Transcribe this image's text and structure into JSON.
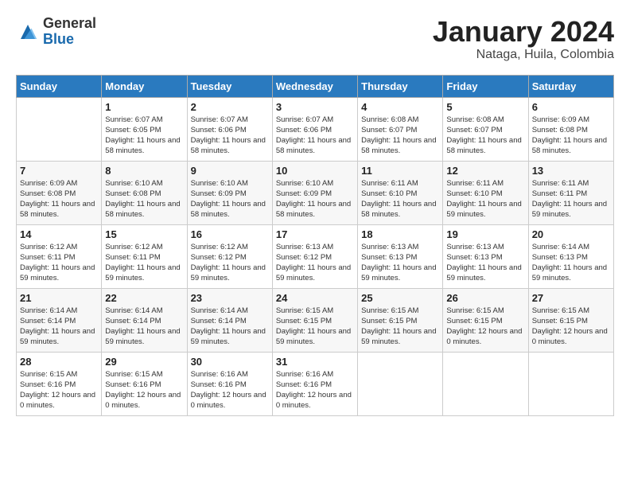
{
  "header": {
    "logo_general": "General",
    "logo_blue": "Blue",
    "month_title": "January 2024",
    "subtitle": "Nataga, Huila, Colombia"
  },
  "weekdays": [
    "Sunday",
    "Monday",
    "Tuesday",
    "Wednesday",
    "Thursday",
    "Friday",
    "Saturday"
  ],
  "weeks": [
    [
      {
        "day": "",
        "sunrise": "",
        "sunset": "",
        "daylight": ""
      },
      {
        "day": "1",
        "sunrise": "Sunrise: 6:07 AM",
        "sunset": "Sunset: 6:05 PM",
        "daylight": "Daylight: 11 hours and 58 minutes."
      },
      {
        "day": "2",
        "sunrise": "Sunrise: 6:07 AM",
        "sunset": "Sunset: 6:06 PM",
        "daylight": "Daylight: 11 hours and 58 minutes."
      },
      {
        "day": "3",
        "sunrise": "Sunrise: 6:07 AM",
        "sunset": "Sunset: 6:06 PM",
        "daylight": "Daylight: 11 hours and 58 minutes."
      },
      {
        "day": "4",
        "sunrise": "Sunrise: 6:08 AM",
        "sunset": "Sunset: 6:07 PM",
        "daylight": "Daylight: 11 hours and 58 minutes."
      },
      {
        "day": "5",
        "sunrise": "Sunrise: 6:08 AM",
        "sunset": "Sunset: 6:07 PM",
        "daylight": "Daylight: 11 hours and 58 minutes."
      },
      {
        "day": "6",
        "sunrise": "Sunrise: 6:09 AM",
        "sunset": "Sunset: 6:08 PM",
        "daylight": "Daylight: 11 hours and 58 minutes."
      }
    ],
    [
      {
        "day": "7",
        "sunrise": "Sunrise: 6:09 AM",
        "sunset": "Sunset: 6:08 PM",
        "daylight": "Daylight: 11 hours and 58 minutes."
      },
      {
        "day": "8",
        "sunrise": "Sunrise: 6:10 AM",
        "sunset": "Sunset: 6:08 PM",
        "daylight": "Daylight: 11 hours and 58 minutes."
      },
      {
        "day": "9",
        "sunrise": "Sunrise: 6:10 AM",
        "sunset": "Sunset: 6:09 PM",
        "daylight": "Daylight: 11 hours and 58 minutes."
      },
      {
        "day": "10",
        "sunrise": "Sunrise: 6:10 AM",
        "sunset": "Sunset: 6:09 PM",
        "daylight": "Daylight: 11 hours and 58 minutes."
      },
      {
        "day": "11",
        "sunrise": "Sunrise: 6:11 AM",
        "sunset": "Sunset: 6:10 PM",
        "daylight": "Daylight: 11 hours and 58 minutes."
      },
      {
        "day": "12",
        "sunrise": "Sunrise: 6:11 AM",
        "sunset": "Sunset: 6:10 PM",
        "daylight": "Daylight: 11 hours and 59 minutes."
      },
      {
        "day": "13",
        "sunrise": "Sunrise: 6:11 AM",
        "sunset": "Sunset: 6:11 PM",
        "daylight": "Daylight: 11 hours and 59 minutes."
      }
    ],
    [
      {
        "day": "14",
        "sunrise": "Sunrise: 6:12 AM",
        "sunset": "Sunset: 6:11 PM",
        "daylight": "Daylight: 11 hours and 59 minutes."
      },
      {
        "day": "15",
        "sunrise": "Sunrise: 6:12 AM",
        "sunset": "Sunset: 6:11 PM",
        "daylight": "Daylight: 11 hours and 59 minutes."
      },
      {
        "day": "16",
        "sunrise": "Sunrise: 6:12 AM",
        "sunset": "Sunset: 6:12 PM",
        "daylight": "Daylight: 11 hours and 59 minutes."
      },
      {
        "day": "17",
        "sunrise": "Sunrise: 6:13 AM",
        "sunset": "Sunset: 6:12 PM",
        "daylight": "Daylight: 11 hours and 59 minutes."
      },
      {
        "day": "18",
        "sunrise": "Sunrise: 6:13 AM",
        "sunset": "Sunset: 6:13 PM",
        "daylight": "Daylight: 11 hours and 59 minutes."
      },
      {
        "day": "19",
        "sunrise": "Sunrise: 6:13 AM",
        "sunset": "Sunset: 6:13 PM",
        "daylight": "Daylight: 11 hours and 59 minutes."
      },
      {
        "day": "20",
        "sunrise": "Sunrise: 6:14 AM",
        "sunset": "Sunset: 6:13 PM",
        "daylight": "Daylight: 11 hours and 59 minutes."
      }
    ],
    [
      {
        "day": "21",
        "sunrise": "Sunrise: 6:14 AM",
        "sunset": "Sunset: 6:14 PM",
        "daylight": "Daylight: 11 hours and 59 minutes."
      },
      {
        "day": "22",
        "sunrise": "Sunrise: 6:14 AM",
        "sunset": "Sunset: 6:14 PM",
        "daylight": "Daylight: 11 hours and 59 minutes."
      },
      {
        "day": "23",
        "sunrise": "Sunrise: 6:14 AM",
        "sunset": "Sunset: 6:14 PM",
        "daylight": "Daylight: 11 hours and 59 minutes."
      },
      {
        "day": "24",
        "sunrise": "Sunrise: 6:15 AM",
        "sunset": "Sunset: 6:15 PM",
        "daylight": "Daylight: 11 hours and 59 minutes."
      },
      {
        "day": "25",
        "sunrise": "Sunrise: 6:15 AM",
        "sunset": "Sunset: 6:15 PM",
        "daylight": "Daylight: 11 hours and 59 minutes."
      },
      {
        "day": "26",
        "sunrise": "Sunrise: 6:15 AM",
        "sunset": "Sunset: 6:15 PM",
        "daylight": "Daylight: 12 hours and 0 minutes."
      },
      {
        "day": "27",
        "sunrise": "Sunrise: 6:15 AM",
        "sunset": "Sunset: 6:15 PM",
        "daylight": "Daylight: 12 hours and 0 minutes."
      }
    ],
    [
      {
        "day": "28",
        "sunrise": "Sunrise: 6:15 AM",
        "sunset": "Sunset: 6:16 PM",
        "daylight": "Daylight: 12 hours and 0 minutes."
      },
      {
        "day": "29",
        "sunrise": "Sunrise: 6:15 AM",
        "sunset": "Sunset: 6:16 PM",
        "daylight": "Daylight: 12 hours and 0 minutes."
      },
      {
        "day": "30",
        "sunrise": "Sunrise: 6:16 AM",
        "sunset": "Sunset: 6:16 PM",
        "daylight": "Daylight: 12 hours and 0 minutes."
      },
      {
        "day": "31",
        "sunrise": "Sunrise: 6:16 AM",
        "sunset": "Sunset: 6:16 PM",
        "daylight": "Daylight: 12 hours and 0 minutes."
      },
      {
        "day": "",
        "sunrise": "",
        "sunset": "",
        "daylight": ""
      },
      {
        "day": "",
        "sunrise": "",
        "sunset": "",
        "daylight": ""
      },
      {
        "day": "",
        "sunrise": "",
        "sunset": "",
        "daylight": ""
      }
    ]
  ]
}
